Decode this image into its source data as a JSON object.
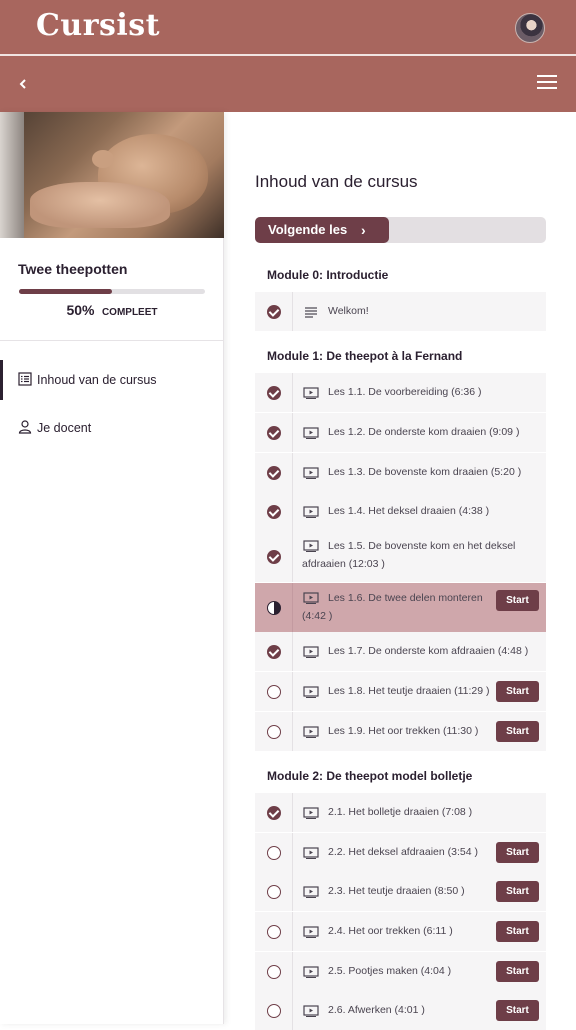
{
  "header": {
    "logo": "Cursist",
    "avatar_icon": "user-avatar"
  },
  "subbar": {
    "back_icon": "chevron-left-icon",
    "menu_icon": "hamburger-menu-icon"
  },
  "sidebar": {
    "course_title": "Twee theepotten",
    "progress": {
      "value": 50,
      "percent_text": "50%",
      "label": "COMPLEET"
    },
    "nav": [
      {
        "label": "Inhoud van de cursus",
        "icon": "list-icon",
        "active": true
      },
      {
        "label": "Je docent",
        "icon": "person-icon",
        "active": false
      }
    ]
  },
  "main": {
    "title": "Inhoud van de cursus",
    "next_button": "Volgende les",
    "modules": [
      {
        "title": "Module 0: Introductie",
        "lessons": [
          {
            "text": "Welkom!",
            "type": "text",
            "status": "done"
          }
        ]
      },
      {
        "title": "Module 1: De theepot à la Fernand",
        "lessons": [
          {
            "text": "Les 1.1. De voorbereiding (6:36 )",
            "type": "video",
            "status": "done"
          },
          {
            "text": "Les 1.2. De onderste kom draaien (9:09 )",
            "type": "video",
            "status": "done"
          },
          {
            "text": "Les 1.3. De bovenste kom draaien (5:20 )",
            "type": "video",
            "status": "done"
          },
          {
            "text": "Les 1.4. Het deksel draaien (4:38 )",
            "type": "video",
            "status": "done"
          },
          {
            "text_line1": "Les 1.5. De bovenste kom en het deksel",
            "text_line2": "afdraaien (12:03 )",
            "type": "video",
            "status": "done"
          },
          {
            "text_line1": "Les 1.6. De twee delen monteren",
            "text_line2": "(4:42 )",
            "type": "video",
            "status": "current",
            "button": "Start"
          },
          {
            "text": "Les 1.7. De onderste kom afdraaien (4:48 )",
            "type": "video",
            "status": "done"
          },
          {
            "text": "Les 1.8. Het teutje draaien (11:29 )",
            "type": "video",
            "status": "todo",
            "button": "Start"
          },
          {
            "text": "Les 1.9. Het oor trekken (11:30 )",
            "type": "video",
            "status": "todo",
            "button": "Start"
          }
        ]
      },
      {
        "title": "Module 2: De theepot model bolletje",
        "lessons": [
          {
            "text": "2.1. Het bolletje draaien (7:08 )",
            "type": "video",
            "status": "done"
          },
          {
            "text": "2.2. Het deksel afdraaien (3:54 )",
            "type": "video",
            "status": "todo",
            "button": "Start"
          },
          {
            "text": "2.3. Het teutje draaien (8:50 )",
            "type": "video",
            "status": "todo",
            "button": "Start"
          },
          {
            "text": "2.4. Het oor trekken (6:11 )",
            "type": "video",
            "status": "todo",
            "button": "Start"
          },
          {
            "text": "2.5. Pootjes maken (4:04 )",
            "type": "video",
            "status": "todo",
            "button": "Start"
          },
          {
            "text": "2.6. Afwerken (4:01 )",
            "type": "video",
            "status": "todo",
            "button": "Start"
          }
        ]
      }
    ]
  },
  "colors": {
    "header": "#a8665e",
    "accent": "#6e3e48",
    "current_row": "#cfa7ab",
    "row_bg": "#f6f5f6"
  }
}
